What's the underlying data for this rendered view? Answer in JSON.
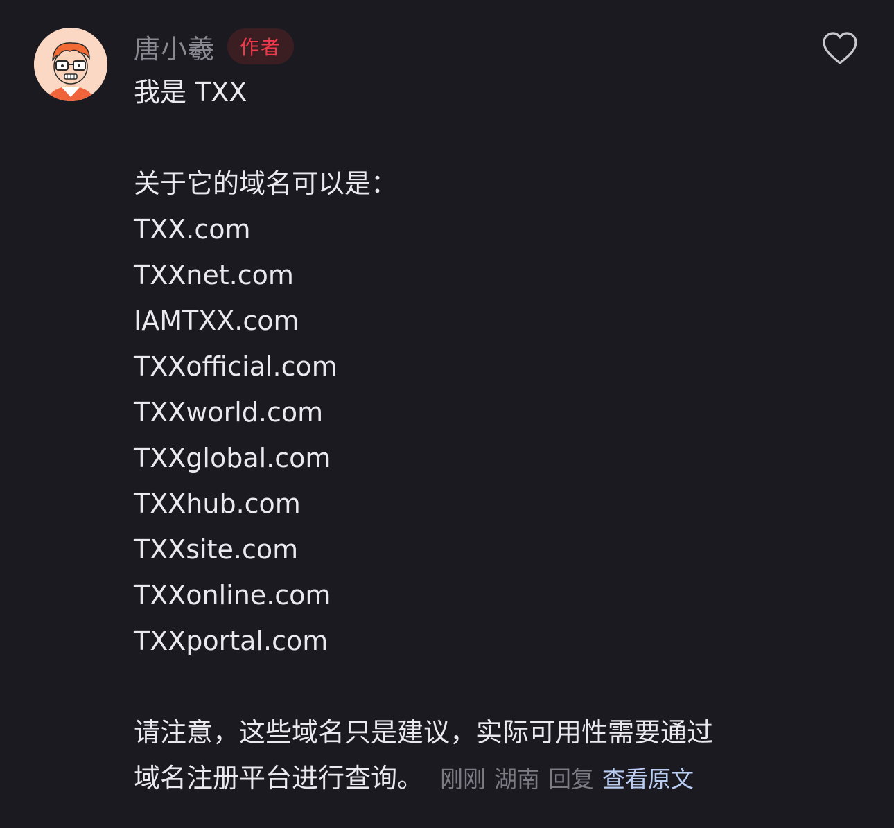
{
  "comment": {
    "username": "唐小羲",
    "author_badge": "作者",
    "intro": "我是 TXX",
    "list_heading": "关于它的域名可以是：",
    "domains": [
      "TXX.com",
      "TXXnet.com",
      "IAMTXX.com",
      "TXXofficial.com",
      "TXXworld.com",
      "TXXglobal.com",
      "TXXhub.com",
      "TXXsite.com",
      "TXXonline.com",
      "TXXportal.com"
    ],
    "note_line1": "请注意，这些域名只是建议，实际可用性需要通过",
    "note_line2": "域名注册平台进行查询。",
    "time": "刚刚",
    "location": "湖南",
    "reply_label": "回复",
    "view_original_label": "查看原文"
  },
  "icons": {
    "like": "heart-outline-icon",
    "avatar": "cartoon-man-with-glasses-avatar"
  },
  "colors": {
    "background": "#1b1a21",
    "text": "#e9e9ee",
    "muted": "#7c7b84",
    "badge_text": "#f2394b",
    "badge_bg": "#3a1e22",
    "link": "#b9cdf2"
  }
}
